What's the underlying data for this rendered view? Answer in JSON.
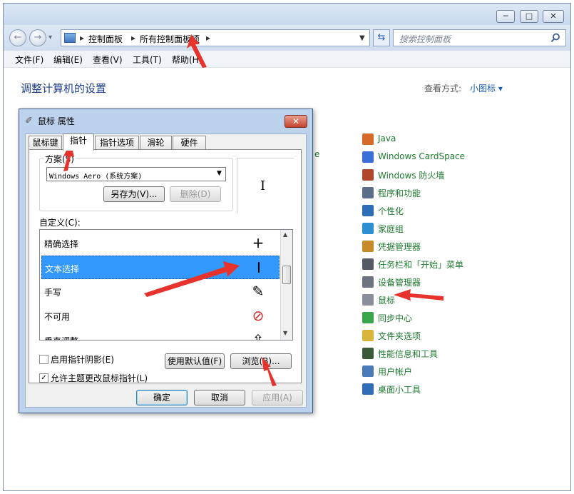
{
  "window": {
    "buttons": {
      "minimize": "─",
      "maximize": "□",
      "close": "✕"
    },
    "nav": {
      "back": "←",
      "forward": "→",
      "dropdown": "▾"
    },
    "breadcrumb": [
      "控制面板",
      "所有控制面板项"
    ],
    "search_placeholder": "搜索控制面板",
    "menu": [
      "文件(F)",
      "编辑(E)",
      "查看(V)",
      "工具(T)",
      "帮助(H)"
    ],
    "heading": "调整计算机的设置",
    "view_by_label": "查看方式:",
    "view_by_value": "小图标 ▾",
    "items": [
      {
        "label": "Java",
        "color": "#d66a2a"
      },
      {
        "label": "Windows CardSpace",
        "color": "#3a6fd8"
      },
      {
        "label": "Windows 防火墙",
        "color": "#b0462c"
      },
      {
        "label": "程序和功能",
        "color": "#5b6f8a"
      },
      {
        "label": "个性化",
        "color": "#2c6fb8"
      },
      {
        "label": "家庭组",
        "color": "#2b8fd1"
      },
      {
        "label": "凭据管理器",
        "color": "#c98a2c"
      },
      {
        "label": "任务栏和「开始」菜单",
        "color": "#555a66"
      },
      {
        "label": "设备管理器",
        "color": "#6d7480"
      },
      {
        "label": "鼠标",
        "color": "#8a8f99"
      },
      {
        "label": "同步中心",
        "color": "#3aa64a"
      },
      {
        "label": "文件夹选项",
        "color": "#d8b53a"
      },
      {
        "label": "性能信息和工具",
        "color": "#3a5a3a"
      },
      {
        "label": "用户帐户",
        "color": "#4a7ab8"
      },
      {
        "label": "桌面小工具",
        "color": "#2f6db8"
      }
    ],
    "partial_text": "e"
  },
  "dialog": {
    "title": "鼠标 属性",
    "close": "✕",
    "tabs": [
      "鼠标键",
      "指针",
      "指针选项",
      "滑轮",
      "硬件"
    ],
    "scheme_label": "方案(S)",
    "scheme_value": "Windows Aero (系统方案)",
    "save_as": "另存为(V)...",
    "delete": "删除(D)",
    "preview_cursor": "I",
    "customize_label": "自定义(C):",
    "cursor_rows": [
      {
        "label": "精确选择",
        "glyph": "+"
      },
      {
        "label": "文本选择",
        "glyph": "I"
      },
      {
        "label": "手写",
        "glyph": "✎"
      },
      {
        "label": "不可用",
        "glyph": "⊘"
      },
      {
        "label": "垂直调整",
        "glyph": "⇧"
      }
    ],
    "scroll_up": "▲",
    "scroll_down": "▼",
    "shadow_label": "启用指针阴影(E)",
    "theme_label": "允许主题更改鼠标指针(L)",
    "theme_check": "✓",
    "use_default": "使用默认值(F)",
    "browse": "浏览(B)...",
    "ok": "确定",
    "cancel": "取消",
    "apply": "应用(A)"
  },
  "colors": {
    "accent": "#3399ff",
    "arrow": "#e8322c",
    "link": "#1e7b2f"
  }
}
